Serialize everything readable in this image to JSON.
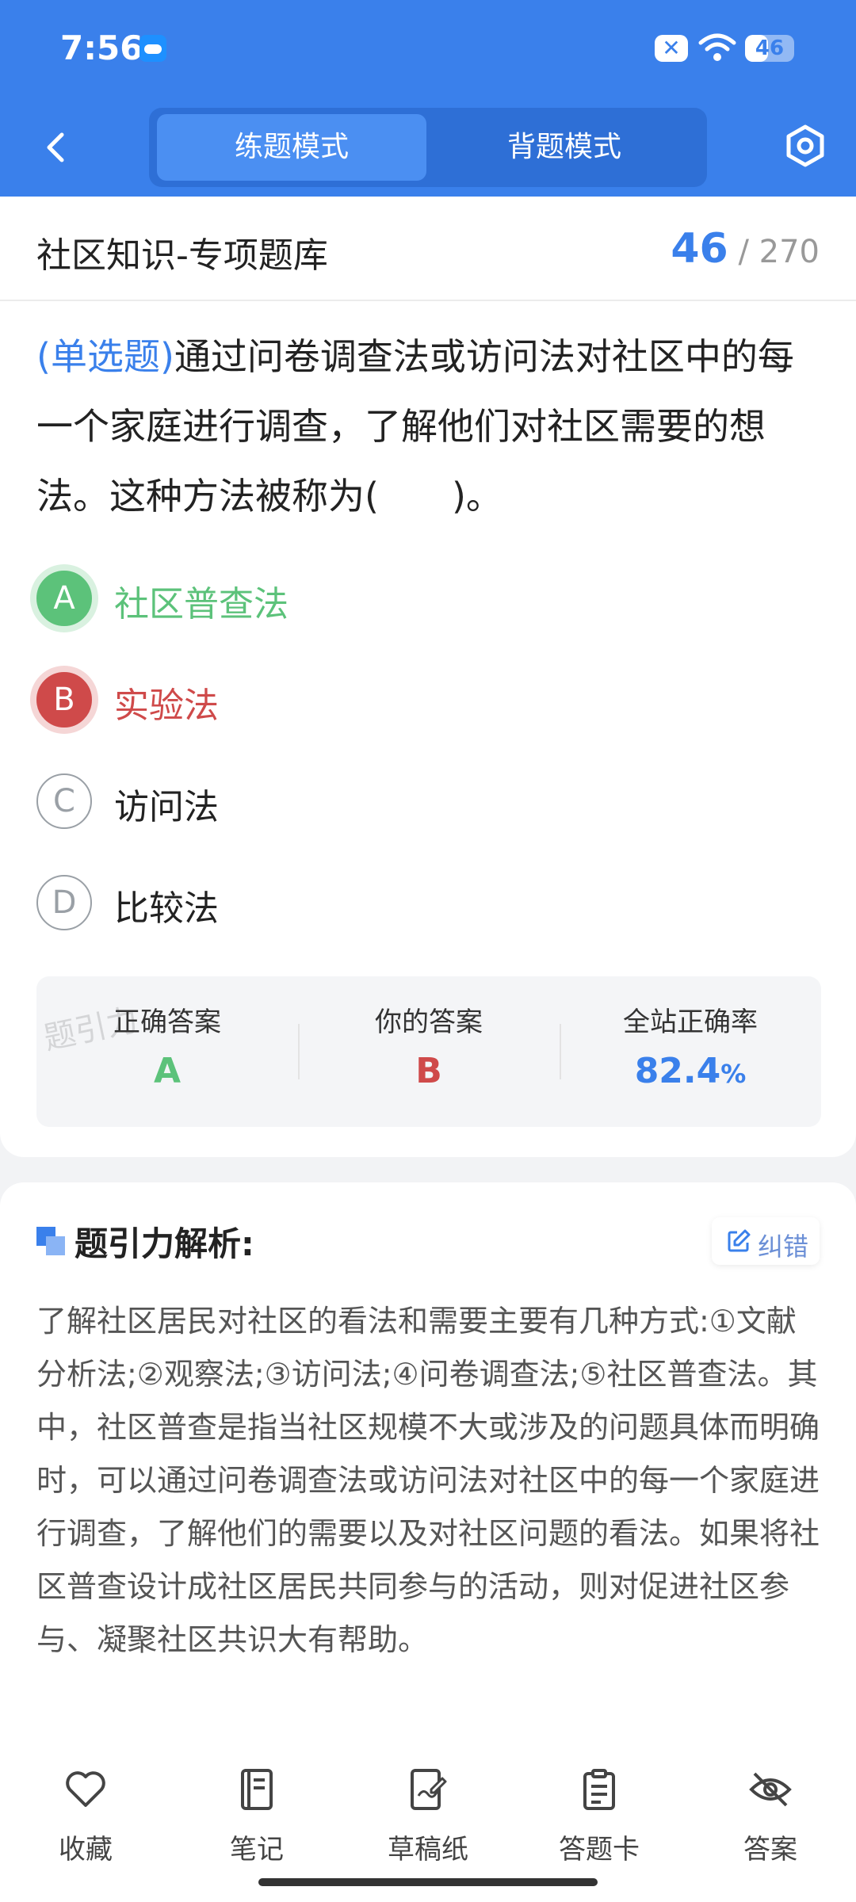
{
  "status_bar": {
    "time": "7:56",
    "battery": "46"
  },
  "nav": {
    "tab_practice": "练题模式",
    "tab_memorize": "背题模式"
  },
  "bank": {
    "title": "社区知识-专项题库",
    "current": "46",
    "separator": "/",
    "total": "270"
  },
  "question": {
    "type": "(单选题)",
    "text": "通过问卷调查法或访问法对社区中的每一个家庭进行调查，了解他们对社区需要的想法。这种方法被称为(　　)。"
  },
  "options": [
    {
      "letter": "A",
      "text": "社区普查法",
      "state": "correct"
    },
    {
      "letter": "B",
      "text": "实验法",
      "state": "wrong"
    },
    {
      "letter": "C",
      "text": "访问法",
      "state": "normal"
    },
    {
      "letter": "D",
      "text": "比较法",
      "state": "normal"
    }
  ],
  "answer_box": {
    "correct_label": "正确答案",
    "correct_value": "A",
    "yours_label": "你的答案",
    "yours_value": "B",
    "rate_label": "全站正确率",
    "rate_value": "82.4",
    "rate_unit": "%",
    "watermark": "题引力"
  },
  "analysis": {
    "title": "题引力解析:",
    "report_label": "纠错",
    "text": "了解社区居民对社区的看法和需要主要有几种方式:①文献分析法;②观察法;③访问法;④问卷调查法;⑤社区普查法。其中，社区普查是指当社区规模不大或涉及的问题具体而明确时，可以通过问卷调查法或访问法对社区中的每一个家庭进行调查，了解他们的需要以及对社区问题的看法。如果将社区普查设计成社区居民共同参与的活动，则对促进社区参与、凝聚社区共识大有帮助。"
  },
  "toolbar": {
    "favorite": "收藏",
    "notes": "笔记",
    "scratch": "草稿纸",
    "answer_card": "答题卡",
    "answer": "答案"
  },
  "colors": {
    "brand": "#3a80eb",
    "correct": "#5cc27a",
    "wrong": "#cf4a4a"
  }
}
